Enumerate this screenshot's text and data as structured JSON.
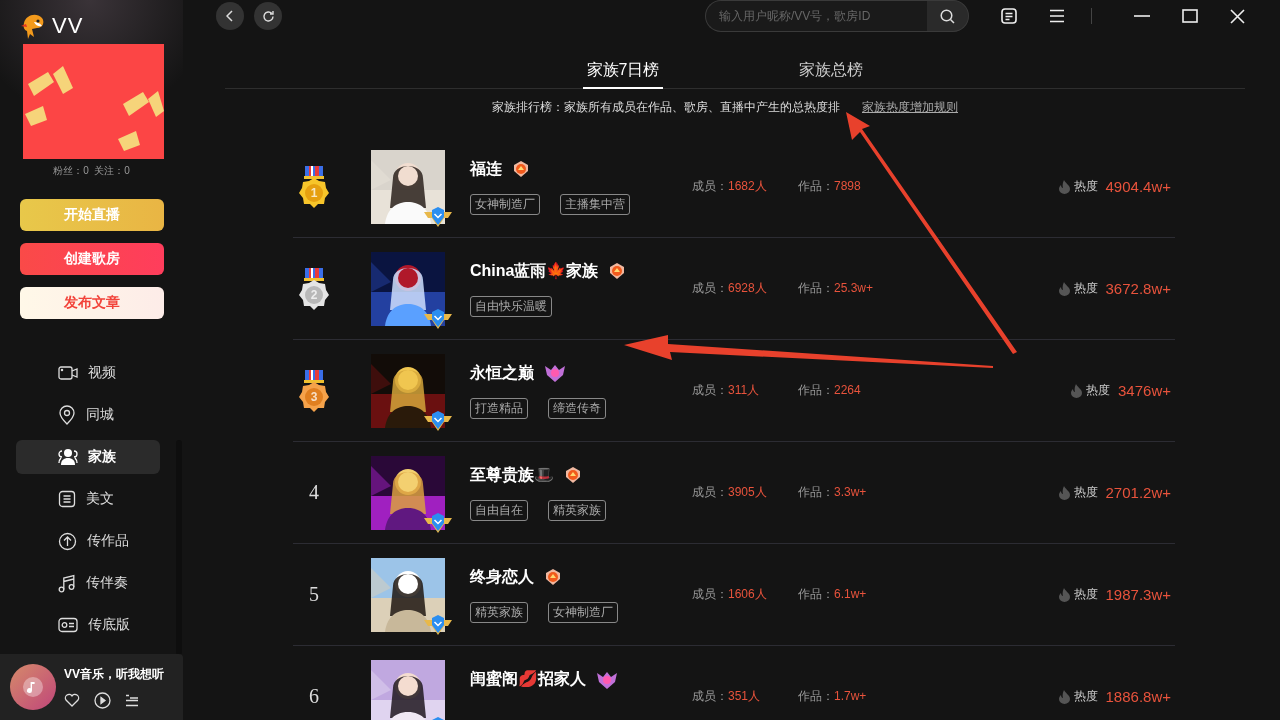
{
  "app": {
    "name": "VV"
  },
  "profile": {
    "stats": "粉丝：0  关注：0"
  },
  "actions": [
    {
      "label": "开始直播",
      "kind": "live"
    },
    {
      "label": "创建歌房",
      "kind": "room"
    },
    {
      "label": "发布文章",
      "kind": "article"
    }
  ],
  "sidebar": {
    "items": [
      {
        "label": "视频",
        "selected": false
      },
      {
        "label": "同城",
        "selected": false
      },
      {
        "label": "家族",
        "selected": true
      },
      {
        "label": "美文",
        "selected": false
      },
      {
        "label": "传作品",
        "selected": false
      },
      {
        "label": "传伴奏",
        "selected": false
      },
      {
        "label": "传底版",
        "selected": false
      }
    ]
  },
  "player": {
    "title": "VV音乐，听我想听"
  },
  "search": {
    "placeholder": "输入用户昵称/VV号，歌房ID"
  },
  "tabs": [
    {
      "label": "家族7日榜",
      "selected": true
    },
    {
      "label": "家族总榜",
      "selected": false
    }
  ],
  "notice": {
    "text": "家族排行榜：家族所有成员在作品、歌房、直播中产生的总热度排",
    "link": "家族热度增加规则"
  },
  "families": [
    {
      "rank": "1",
      "kind": "gold",
      "name": "福连",
      "tags": [
        "女神制造厂",
        "主播集中营"
      ],
      "members_label": "成员：",
      "members": "1682人",
      "works_label": "作品：",
      "works": "7898",
      "heat_label": "热度",
      "heat": "4904.4w+"
    },
    {
      "rank": "2",
      "kind": "silver",
      "name": "China蓝雨🍁家族",
      "tags": [
        "自由快乐温暖"
      ],
      "members_label": "成员：",
      "members": "6928人",
      "works_label": "作品：",
      "works": "25.3w+",
      "heat_label": "热度",
      "heat": "3672.8w+"
    },
    {
      "rank": "3",
      "kind": "bronze",
      "name": "永恒之巅",
      "tags": [
        "打造精品",
        "缔造传奇"
      ],
      "members_label": "成员：",
      "members": "311人",
      "works_label": "作品：",
      "works": "2264",
      "heat_label": "热度",
      "heat": "3476w+"
    },
    {
      "rank": "4",
      "kind": "plain",
      "name": "至尊贵族🎩",
      "tags": [
        "自由自在",
        "精英家族"
      ],
      "members_label": "成员：",
      "members": "3905人",
      "works_label": "作品：",
      "works": "3.3w+",
      "heat_label": "热度",
      "heat": "2701.2w+"
    },
    {
      "rank": "5",
      "kind": "plain",
      "name": "终身恋人",
      "tags": [
        "精英家族",
        "女神制造厂"
      ],
      "members_label": "成员：",
      "members": "1606人",
      "works_label": "作品：",
      "works": "6.1w+",
      "heat_label": "热度",
      "heat": "1987.3w+"
    },
    {
      "rank": "6",
      "kind": "plain",
      "name": "闺蜜阁💋招家人",
      "members_label": "成员：",
      "members": "351人",
      "works_label": "作品：",
      "works": "1.7w+",
      "heat_label": "热度",
      "heat": "1886.8w+"
    }
  ]
}
